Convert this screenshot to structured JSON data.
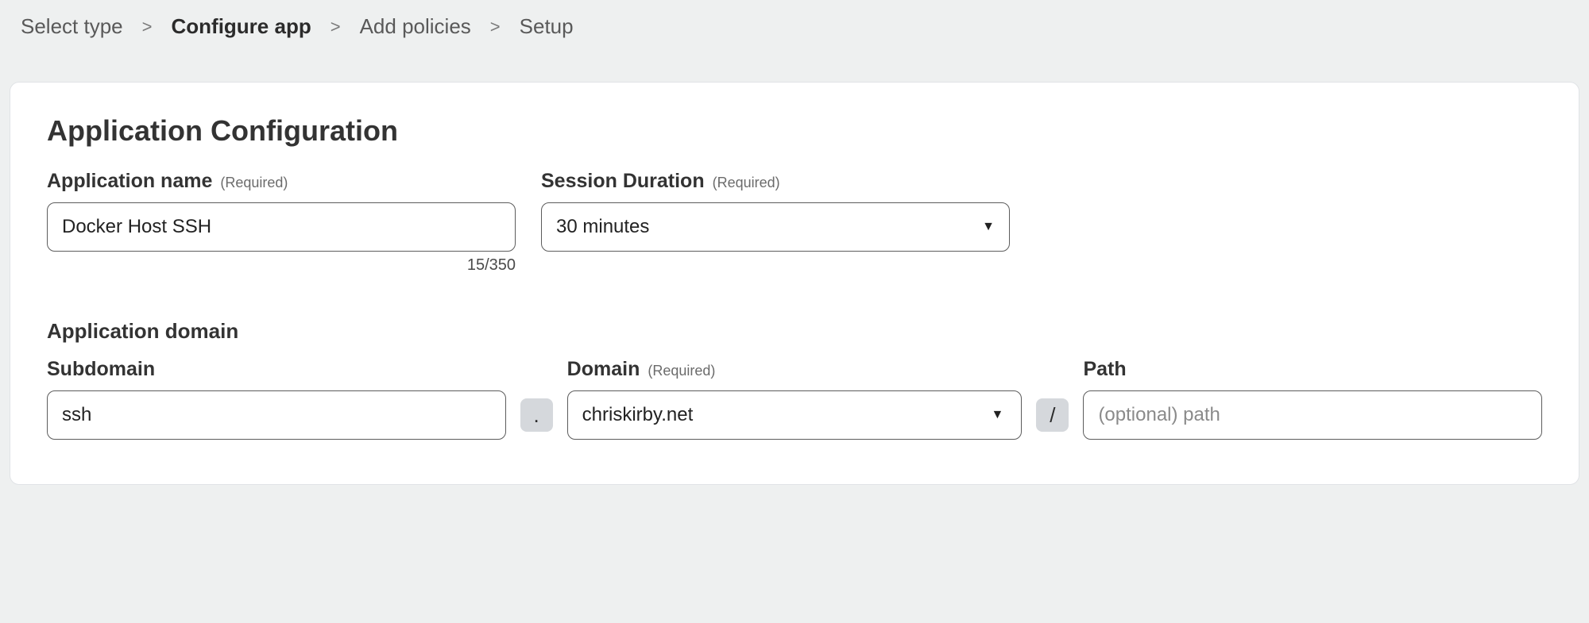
{
  "breadcrumb": {
    "steps": [
      {
        "label": "Select type",
        "active": false
      },
      {
        "label": "Configure app",
        "active": true
      },
      {
        "label": "Add policies",
        "active": false
      },
      {
        "label": "Setup",
        "active": false
      }
    ],
    "sep": ">"
  },
  "card": {
    "title": "Application Configuration",
    "app_name": {
      "label": "Application name",
      "required": "(Required)",
      "value": "Docker Host SSH",
      "counter": "15/350"
    },
    "session": {
      "label": "Session Duration",
      "required": "(Required)",
      "value": "30 minutes"
    },
    "domain_section": {
      "heading": "Application domain",
      "subdomain": {
        "label": "Subdomain",
        "value": "ssh"
      },
      "dot": ".",
      "domain": {
        "label": "Domain",
        "required": "(Required)",
        "value": "chriskirby.net"
      },
      "slash": "/",
      "path": {
        "label": "Path",
        "placeholder": "(optional) path",
        "value": ""
      }
    }
  }
}
